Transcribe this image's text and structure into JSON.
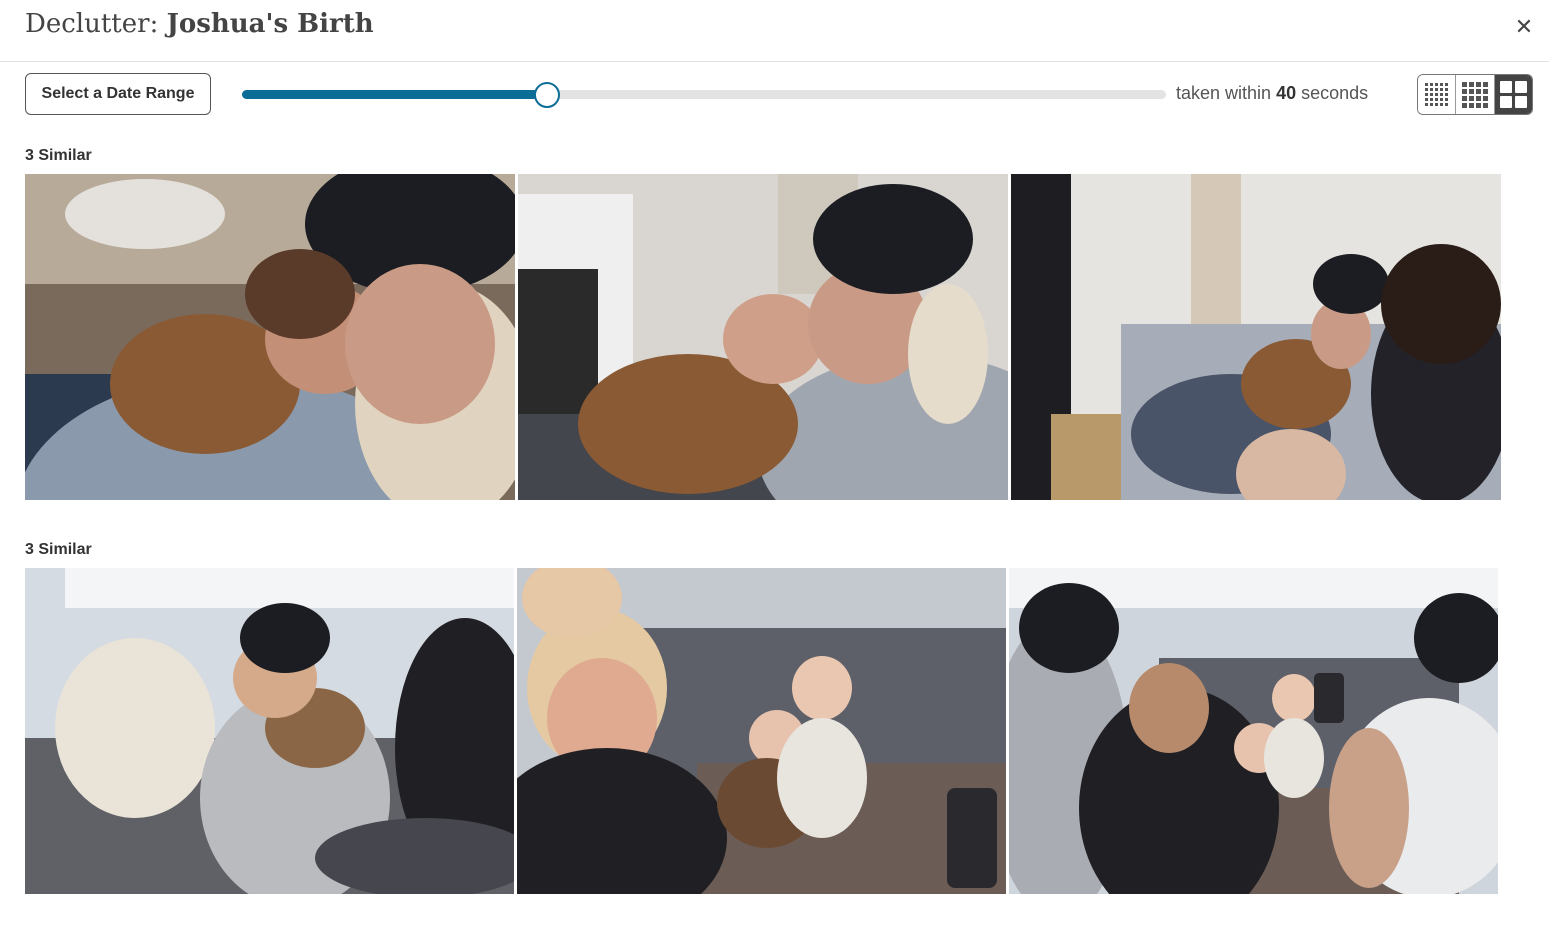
{
  "header": {
    "title_prefix": "Declutter:",
    "title_name": "Joshua's Birth",
    "close_symbol": "✕"
  },
  "toolbar": {
    "date_range_label": "Select a Date Range",
    "slider_value_fraction": 0.33,
    "taken_prefix": "taken within",
    "taken_value": "40",
    "taken_suffix": "seconds",
    "view_options": [
      "small-grid",
      "medium-grid",
      "large-grid"
    ],
    "active_view": "large-grid"
  },
  "groups": [
    {
      "label": "3 Similar",
      "photos": [
        {
          "icon": "photo-grandma-cuddling-newborn-closeup"
        },
        {
          "icon": "photo-grandma-holding-newborn-on-couch"
        },
        {
          "icon": "photo-family-on-couch-with-newborn"
        }
      ]
    },
    {
      "label": "3 Similar",
      "photos": [
        {
          "icon": "photo-woman-holding-newborn-on-sofa"
        },
        {
          "icon": "photo-woman-laughing-babies-on-sofa"
        },
        {
          "icon": "photo-family-photographing-babies"
        }
      ]
    }
  ],
  "colors": {
    "accent": "#0c6e97",
    "track": "#e3e3e3",
    "active_view_bg": "#444444"
  }
}
